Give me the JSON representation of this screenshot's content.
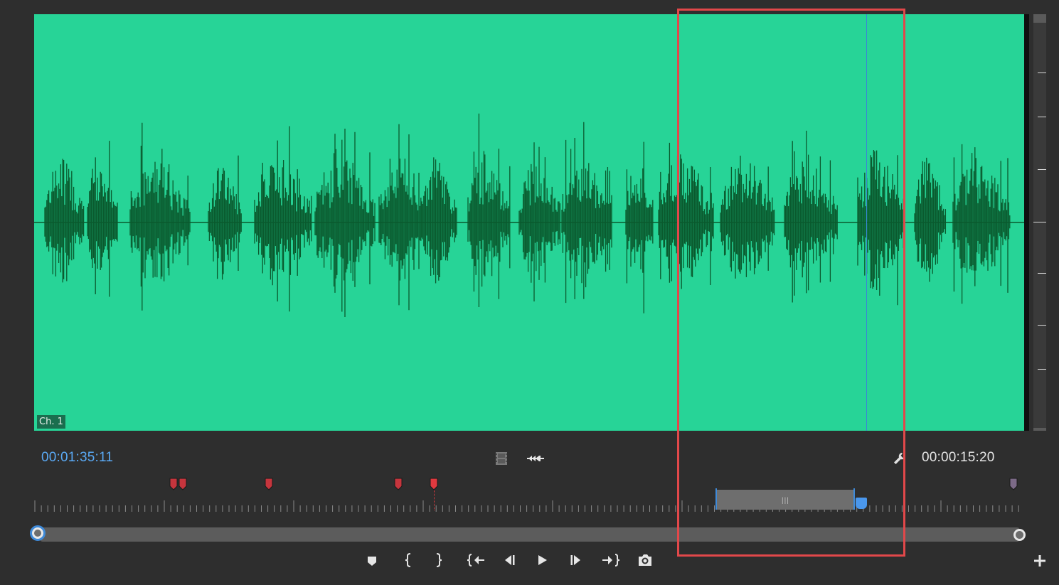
{
  "panel": {
    "channel_label": "Ch. 1",
    "waveform_color": "#0a5a2e",
    "background_color": "#27d497"
  },
  "timecodes": {
    "playhead": "00:01:35:11",
    "duration": "00:00:15:20"
  },
  "toolbar_top": {
    "icons": [
      "filmstrip-icon",
      "audio-scrub-icon",
      "wrench-icon"
    ]
  },
  "markers": {
    "colors": [
      "#c6353d",
      "#c6353d",
      "#c6353d",
      "#c6353d",
      "#e0393f",
      "#7c6a87"
    ]
  },
  "transport": {
    "buttons": [
      {
        "name": "add-marker-button",
        "icon": "marker-icon"
      },
      {
        "name": "mark-in-button",
        "icon": "mark-in-icon"
      },
      {
        "name": "mark-out-button",
        "icon": "mark-out-icon"
      },
      {
        "name": "go-to-in-button",
        "icon": "go-to-in-icon"
      },
      {
        "name": "step-back-button",
        "icon": "step-back-icon"
      },
      {
        "name": "play-button",
        "icon": "play-icon"
      },
      {
        "name": "step-forward-button",
        "icon": "step-forward-icon"
      },
      {
        "name": "go-to-out-button",
        "icon": "go-to-out-icon"
      },
      {
        "name": "export-frame-button",
        "icon": "camera-icon"
      }
    ],
    "extra": {
      "name": "button-editor-button",
      "icon": "plus-icon"
    }
  },
  "accent_colors": {
    "playhead": "#3b86d6",
    "highlight": "#e2484a"
  }
}
